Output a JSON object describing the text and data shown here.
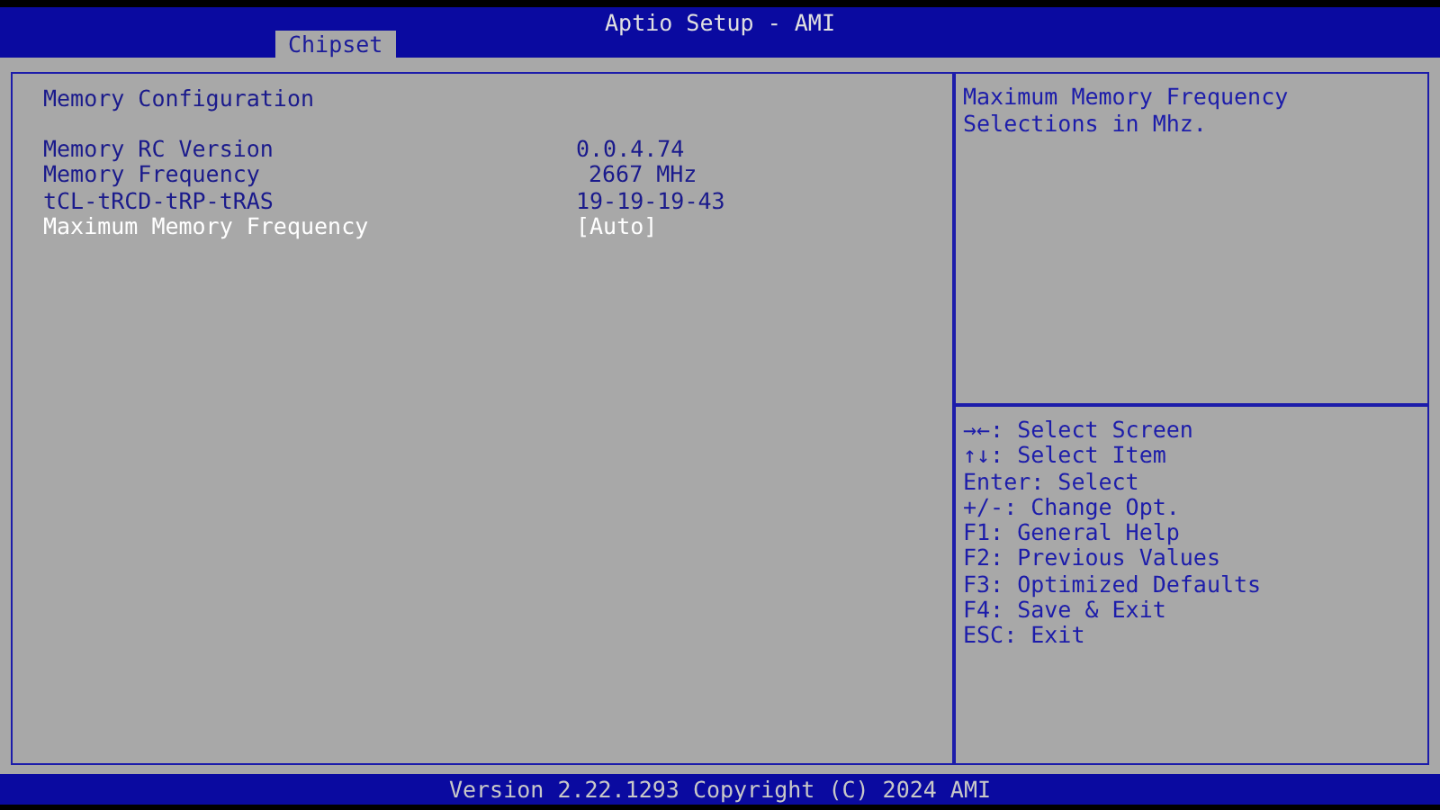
{
  "window": {
    "title": "Aptio Setup - AMI"
  },
  "tabs": [
    {
      "label": "Chipset",
      "selected": true
    }
  ],
  "section": {
    "title": "Memory Configuration"
  },
  "rows": [
    {
      "kind": "info",
      "label": "Memory RC Version",
      "value": "0.0.4.74"
    },
    {
      "kind": "info",
      "label": "Memory Frequency",
      "value": "2667 MHz"
    },
    {
      "kind": "info",
      "label": "tCL-tRCD-tRP-tRAS",
      "value": "19-19-19-43"
    },
    {
      "kind": "setting",
      "label": "Maximum Memory Frequency",
      "value": "[Auto]",
      "selected": true
    }
  ],
  "help": {
    "text": "Maximum Memory Frequency Selections in Mhz."
  },
  "keys": [
    {
      "key": "→←:",
      "action": "Select Screen"
    },
    {
      "key": "↑↓:",
      "action": "Select Item"
    },
    {
      "key": "Enter:",
      "action": "Select"
    },
    {
      "key": "+/-:",
      "action": "Change Opt."
    },
    {
      "key": "F1:",
      "action": "General Help"
    },
    {
      "key": "F2:",
      "action": "Previous Values"
    },
    {
      "key": "F3:",
      "action": "Optimized Defaults"
    },
    {
      "key": "F4:",
      "action": "Save & Exit"
    },
    {
      "key": "ESC:",
      "action": "Exit"
    }
  ],
  "status_bar": {
    "text": "Version 2.22.1293 Copyright (C) 2024 AMI"
  }
}
